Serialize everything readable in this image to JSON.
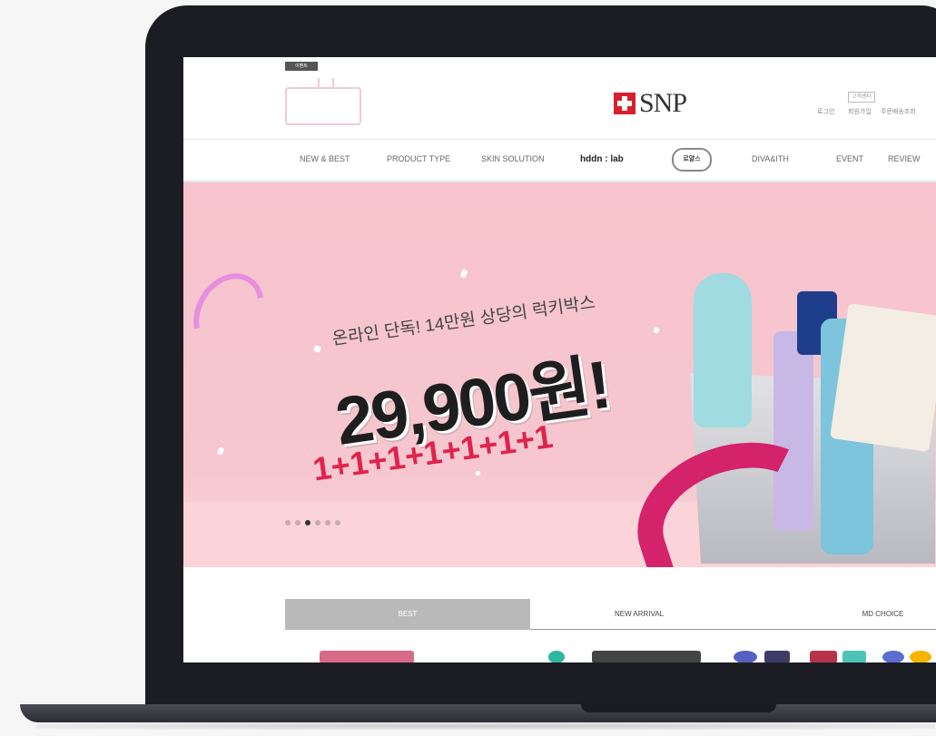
{
  "header": {
    "badge": "이벤트",
    "logo_text": "SNP",
    "util_top": "고객센터",
    "util_links": [
      "로그인",
      "회원가입",
      "주문배송조회"
    ]
  },
  "nav": {
    "items": [
      "NEW & BEST",
      "PRODUCT TYPE",
      "SKIN SOLUTION",
      "hddn : lab",
      "DIVA&ITH",
      "EVENT",
      "REVIEW"
    ],
    "emblem": "로얄스"
  },
  "banner": {
    "tagline": "온라인 단독! 14만원 상당의 럭키박스",
    "price": "29,900원!",
    "plus_line": "1+1+1+1+1+1+1",
    "slides_total": 6,
    "slide_active_index": 2,
    "colors": {
      "bg": "#f7c3cc",
      "accent": "#e0234e",
      "ribbon": "#d4236a"
    }
  },
  "tabs": {
    "items": [
      "BEST",
      "NEW ARRIVAL",
      "MD CHOICE"
    ],
    "active_index": 0
  },
  "icons": [
    "snp-cross-logo",
    "tv-icon",
    "slider-dot"
  ]
}
